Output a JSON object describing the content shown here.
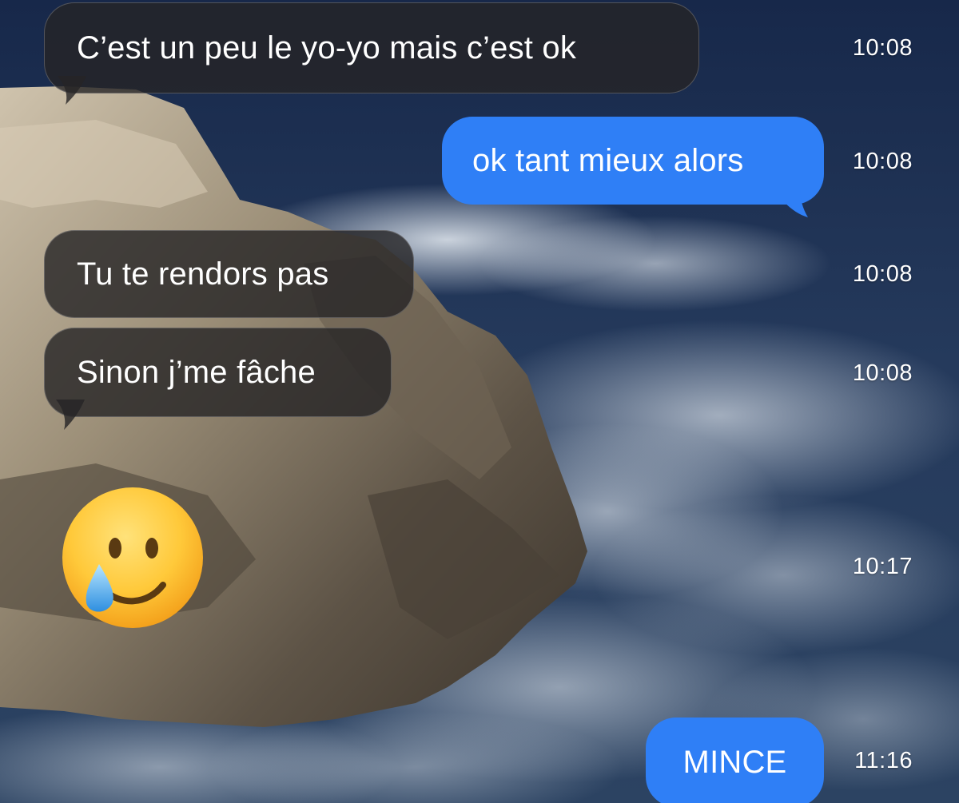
{
  "conversation": {
    "messages": [
      {
        "direction": "incoming",
        "text": "C’est un peu le yo-yo mais c’est ok",
        "time": "10:08"
      },
      {
        "direction": "outgoing",
        "text": "ok tant mieux alors",
        "time": "10:08"
      },
      {
        "direction": "incoming",
        "text": "Tu te rendors pas",
        "time": "10:08"
      },
      {
        "direction": "incoming",
        "text": "Sinon j’me fâche",
        "time": "10:08"
      },
      {
        "direction": "incoming",
        "emoji": "smiling-face-with-tear",
        "time": "10:17"
      },
      {
        "direction": "outgoing",
        "text": "MINCE",
        "time": "11:16"
      }
    ]
  },
  "theme": {
    "incoming_bubble": "#262426",
    "outgoing_bubble": "#2f7ff6",
    "text": "#ffffff"
  }
}
